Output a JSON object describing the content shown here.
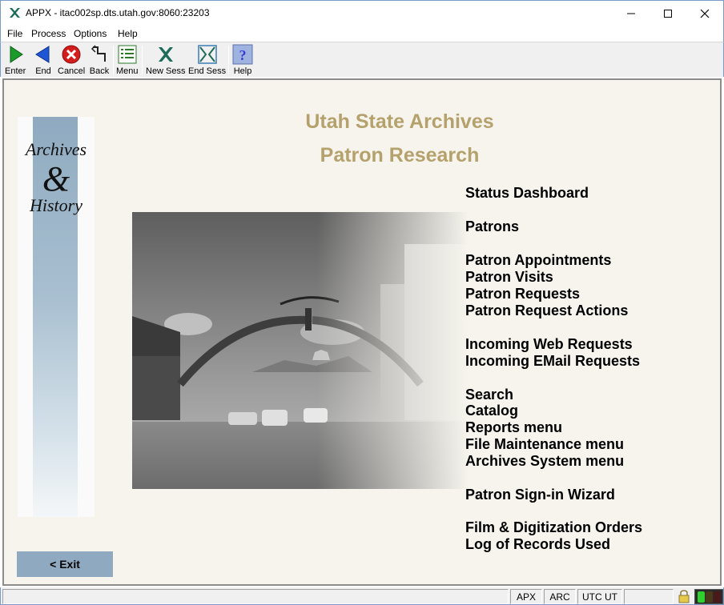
{
  "window": {
    "title": "APPX - itac002sp.dts.utah.gov:8060:23203",
    "icon": "appx-x-icon",
    "minimize": "—",
    "maximize": "☐",
    "close": "✕"
  },
  "menubar": {
    "items": [
      "File",
      "Process",
      "Options",
      "Help"
    ]
  },
  "toolbar": {
    "buttons": [
      {
        "label": "Enter",
        "icon": "enter-green-arrow-icon"
      },
      {
        "label": "End",
        "icon": "end-blue-arrow-icon"
      },
      {
        "label": "Cancel",
        "icon": "cancel-red-x-icon"
      },
      {
        "label": "Back",
        "icon": "back-arrow-icon"
      },
      {
        "label": "Menu",
        "icon": "menu-list-icon"
      },
      {
        "label": "New Sess",
        "icon": "new-session-icon"
      },
      {
        "label": "End Sess",
        "icon": "end-session-icon"
      },
      {
        "label": "Help",
        "icon": "help-question-icon"
      }
    ]
  },
  "brand": {
    "line1": "Archives",
    "line2": "&",
    "line3": "History"
  },
  "page": {
    "title": "Utah State Archives",
    "subtitle": "Patron Research"
  },
  "menu": {
    "status_dashboard": "Status Dashboard",
    "patrons": "Patrons",
    "patron_appointments": "Patron Appointments",
    "patron_visits": "Patron Visits",
    "patron_requests": "Patron Requests",
    "patron_request_actions": "Patron Request Actions",
    "incoming_web_requests": "Incoming Web Requests",
    "incoming_email_requests": "Incoming EMail Requests",
    "search": "Search",
    "catalog": "Catalog",
    "reports_menu": "Reports menu",
    "file_maintenance_menu": "File Maintenance menu",
    "archives_system_menu": "Archives System menu",
    "patron_signin_wizard": "Patron Sign-in Wizard",
    "film_digitization_orders": "Film & Digitization Orders",
    "log_of_records_used": "Log of Records Used"
  },
  "exit_label": "< Exit",
  "statusbar": {
    "message": "",
    "apx": "APX",
    "arc": "ARC",
    "tz": "UTC UT",
    "blank": ""
  },
  "colors": {
    "heading": "#b5a16c",
    "exit_button": "#8faac0",
    "content_bg": "#f6f4ed"
  }
}
